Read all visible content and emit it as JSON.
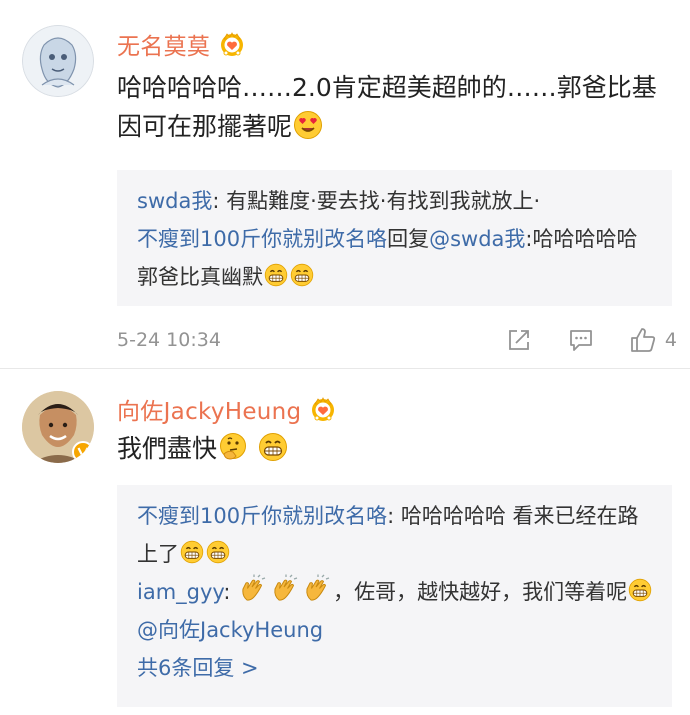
{
  "comments": [
    {
      "username": "无名莫莫",
      "text_main": "哈哈哈哈哈……2.0肯定超美超帥的……郭爸比基因可在那擺著呢",
      "replies": [
        {
          "name": "swda我",
          "sep": ": ",
          "text": "有點難度·要去找·有找到我就放上·"
        },
        {
          "name": "不瘦到100斤你就别改名咯",
          "mid": "回复",
          "mention": "@swda我",
          "sep": ":",
          "text": "哈哈哈哈哈  郭爸比真幽默"
        }
      ],
      "time": "5-24 10:34",
      "like_count": "4"
    },
    {
      "username": "向佐JackyHeung",
      "text_main": "我們盡快",
      "replies": [
        {
          "name": "不瘦到100斤你就别改名咯",
          "sep": ": ",
          "text": "哈哈哈哈哈  看来已经在路上了"
        },
        {
          "name": "iam_gyy",
          "sep": ": ",
          "text": "，佐哥，越快越好，我们等着呢",
          "mention": "@向佐JackyHeung"
        }
      ],
      "more_replies": "共6条回复 >"
    }
  ],
  "colors": {
    "username": "#eb7350",
    "link": "#3e6ba8",
    "meta": "#939393",
    "reply_bg": "#f5f5f7"
  },
  "icons": [
    "crown-badge-icon",
    "share-icon",
    "comment-icon",
    "like-icon",
    "verified-badge-icon",
    "grin-emoji-icon",
    "heart-eyes-emoji-icon",
    "thinking-emoji-icon",
    "clap-emoji-icon"
  ]
}
